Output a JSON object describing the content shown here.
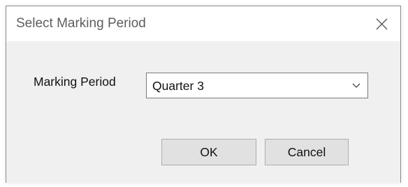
{
  "dialog": {
    "title": "Select Marking Period",
    "close_icon": "close-icon"
  },
  "form": {
    "marking_period_label": "Marking Period",
    "marking_period_value": "Quarter 3",
    "dropdown_icon": "chevron-down-icon"
  },
  "buttons": {
    "ok_label": "OK",
    "cancel_label": "Cancel"
  },
  "colors": {
    "title_text": "#5e5e5e",
    "dialog_bg": "#f0f0f0",
    "button_bg": "#e1e1e1"
  }
}
